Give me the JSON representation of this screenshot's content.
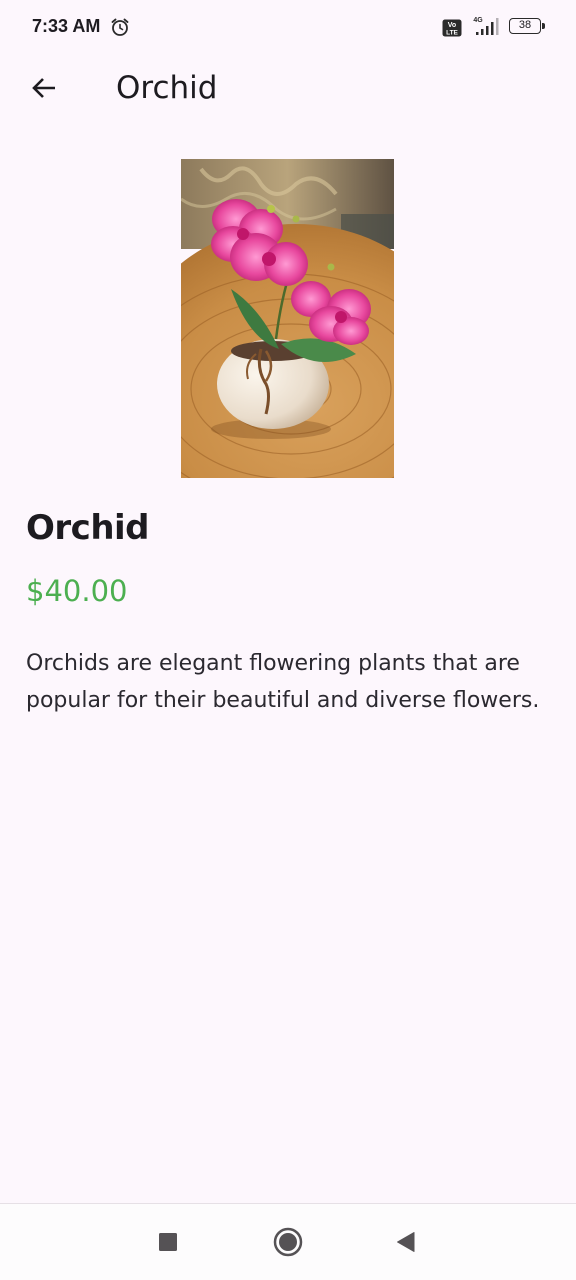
{
  "status_bar": {
    "time": "7:33 AM",
    "battery_level": "38",
    "network_label": "4G",
    "volte_label_top": "Vo",
    "volte_label_bottom": "LTE",
    "icons": [
      "alarm-icon",
      "volte-icon",
      "signal-icon",
      "battery-icon"
    ]
  },
  "app_bar": {
    "title": "Orchid",
    "back_icon": "arrow-left-icon"
  },
  "product": {
    "image_icon": "orchid-photo",
    "name": "Orchid",
    "price": "$40.00",
    "description": "Orchids are elegant flowering plants that are popular for their beautiful and diverse flowers.",
    "price_color": "#4caf50"
  },
  "nav_bar": {
    "recents_icon": "square-icon",
    "home_icon": "circle-icon",
    "back_icon": "triangle-back-icon"
  },
  "colors": {
    "background": "#fdf7fd",
    "text": "#1d1b20"
  }
}
